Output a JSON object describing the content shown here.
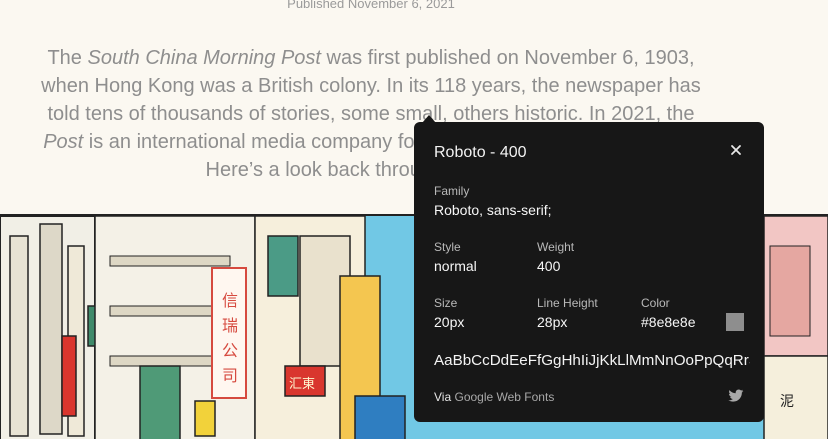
{
  "article": {
    "published": "Published November 6, 2021",
    "intro": {
      "l1_pre": "The ",
      "l1_em": "South China Morning Post",
      "l1_post": " was first published on November 6, 1903,",
      "l2": "when Hong Kong was a British colony. In its 118 years, the newspaper has",
      "l3": "told tens of thousands of stories, some small, others historic. In 2021, the",
      "l4_em": "Post",
      "l4_post": " is an international media company focused on the global China story.",
      "l5": "Here’s a look back through the years."
    }
  },
  "font_popover": {
    "title": "Roboto - 400",
    "close_icon": "close-icon",
    "family_label": "Family",
    "family_value": "Roboto, sans-serif;",
    "style_label": "Style",
    "style_value": "normal",
    "weight_label": "Weight",
    "weight_value": "400",
    "size_label": "Size",
    "size_value": "20px",
    "line_height_label": "Line Height",
    "line_height_value": "28px",
    "color_label": "Color",
    "color_value": "#8e8e8e",
    "swatch_color": "#8e8e8e",
    "sample": "AaBbCcDdEeFfGgHhIiJjKkLlMmNnOoPpQqRrSsTtUuVvWwXxYyZz",
    "via_prefix": "Via",
    "via_link": "Google Web Fonts",
    "share_icon": "twitter-icon"
  }
}
